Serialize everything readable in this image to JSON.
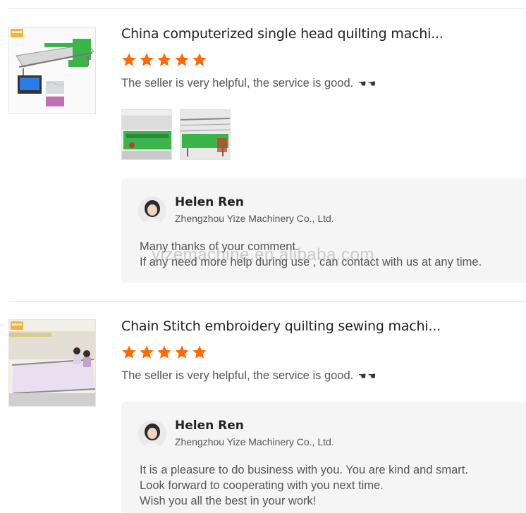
{
  "reviews": [
    {
      "title": "China computerized single head quilting machi...",
      "rating": 5,
      "comment": "The seller is very helpful, the service is good.",
      "comment_icons": [
        "hand-pointing-icon",
        "hand-pointing-icon"
      ],
      "photo_count": 2,
      "reply": {
        "name": "Helen Ren",
        "company": "Zhengzhou Yize Machinery Co., Ltd.",
        "lines": [
          "Many thanks of your comment.",
          "If any need more help during use , can contact with us at any time."
        ]
      }
    },
    {
      "title": "Chain Stitch embroidery quilting sewing machi...",
      "rating": 5,
      "comment": "The seller is very helpful, the service is good.",
      "comment_icons": [
        "hand-pointing-icon",
        "hand-pointing-icon"
      ],
      "photo_count": 0,
      "reply": {
        "name": "Helen Ren",
        "company": "Zhengzhou Yize Machinery Co., Ltd.",
        "lines": [
          "It is a pleasure to do business with you. You are kind and smart.",
          "Look forward to cooperating with you next time.",
          "Wish you all the best in your work!"
        ]
      }
    }
  ],
  "watermark": "yizemachine.en.alibaba.com",
  "colors": {
    "star": "#ff6a00",
    "reply_bg": "#f5f5f5",
    "machine_green": "#3bb54a"
  }
}
